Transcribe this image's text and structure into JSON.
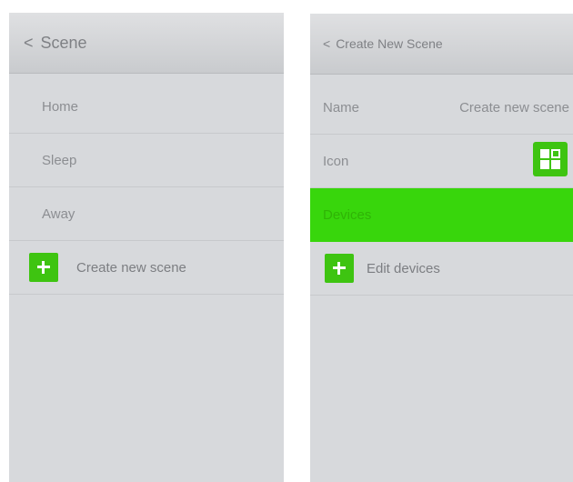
{
  "left_screen": {
    "back_label": "Scene",
    "scenes": [
      "Home",
      "Sleep",
      "Away"
    ],
    "create_label": "Create new scene"
  },
  "right_screen": {
    "back_label": "Create New Scene",
    "name_label": "Name",
    "name_value": "Create new scene",
    "icon_label": "Icon",
    "devices_label": "Devices",
    "edit_devices_label": "Edit devices"
  },
  "colors": {
    "accent_green": "#3ec411",
    "selected_row_green": "#38d60c",
    "background": "#d7d9dc",
    "text_gray": "#8c8e92"
  },
  "icons": {
    "back": "chevron-left-icon",
    "add": "plus-icon",
    "scene_icon": "grid-tile-icon"
  }
}
